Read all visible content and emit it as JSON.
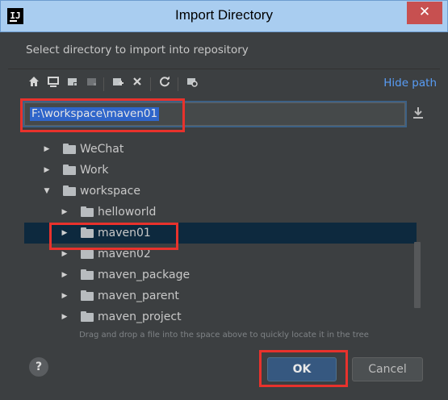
{
  "window": {
    "app_icon": "IJ",
    "title": "Import Directory",
    "close_glyph": "✕"
  },
  "prompt": "Select directory to import into repository",
  "toolbar": {
    "icons": [
      "home-icon",
      "desktop-icon",
      "project-folder-icon",
      "module-folder-icon",
      "new-folder-icon",
      "delete-icon",
      "refresh-icon",
      "show-hidden-icon"
    ],
    "hide_path_label": "Hide path"
  },
  "path_field": {
    "value": "F:\\workspace\\maven01"
  },
  "tree": {
    "items": [
      {
        "label": "WeChat",
        "expanded": false,
        "depth": 1
      },
      {
        "label": "Work",
        "expanded": false,
        "depth": 1
      },
      {
        "label": "workspace",
        "expanded": true,
        "depth": 1
      },
      {
        "label": "helloworld",
        "expanded": false,
        "depth": 2
      },
      {
        "label": "maven01",
        "expanded": false,
        "depth": 2,
        "selected": true
      },
      {
        "label": "maven02",
        "expanded": false,
        "depth": 2
      },
      {
        "label": "maven_package",
        "expanded": false,
        "depth": 2
      },
      {
        "label": "maven_parent",
        "expanded": false,
        "depth": 2
      },
      {
        "label": "maven_project",
        "expanded": false,
        "depth": 2
      }
    ]
  },
  "hint": "Drag and drop a file into the space above to quickly locate it in the tree",
  "footer": {
    "help_label": "?",
    "ok_label": "OK",
    "cancel_label": "Cancel"
  },
  "colors": {
    "background": "#3c3f41",
    "titlebar": "#a9cdf0",
    "selection": "#0d293e",
    "link": "#589df6",
    "ok_button": "#365880",
    "annotation": "#e8322c"
  }
}
